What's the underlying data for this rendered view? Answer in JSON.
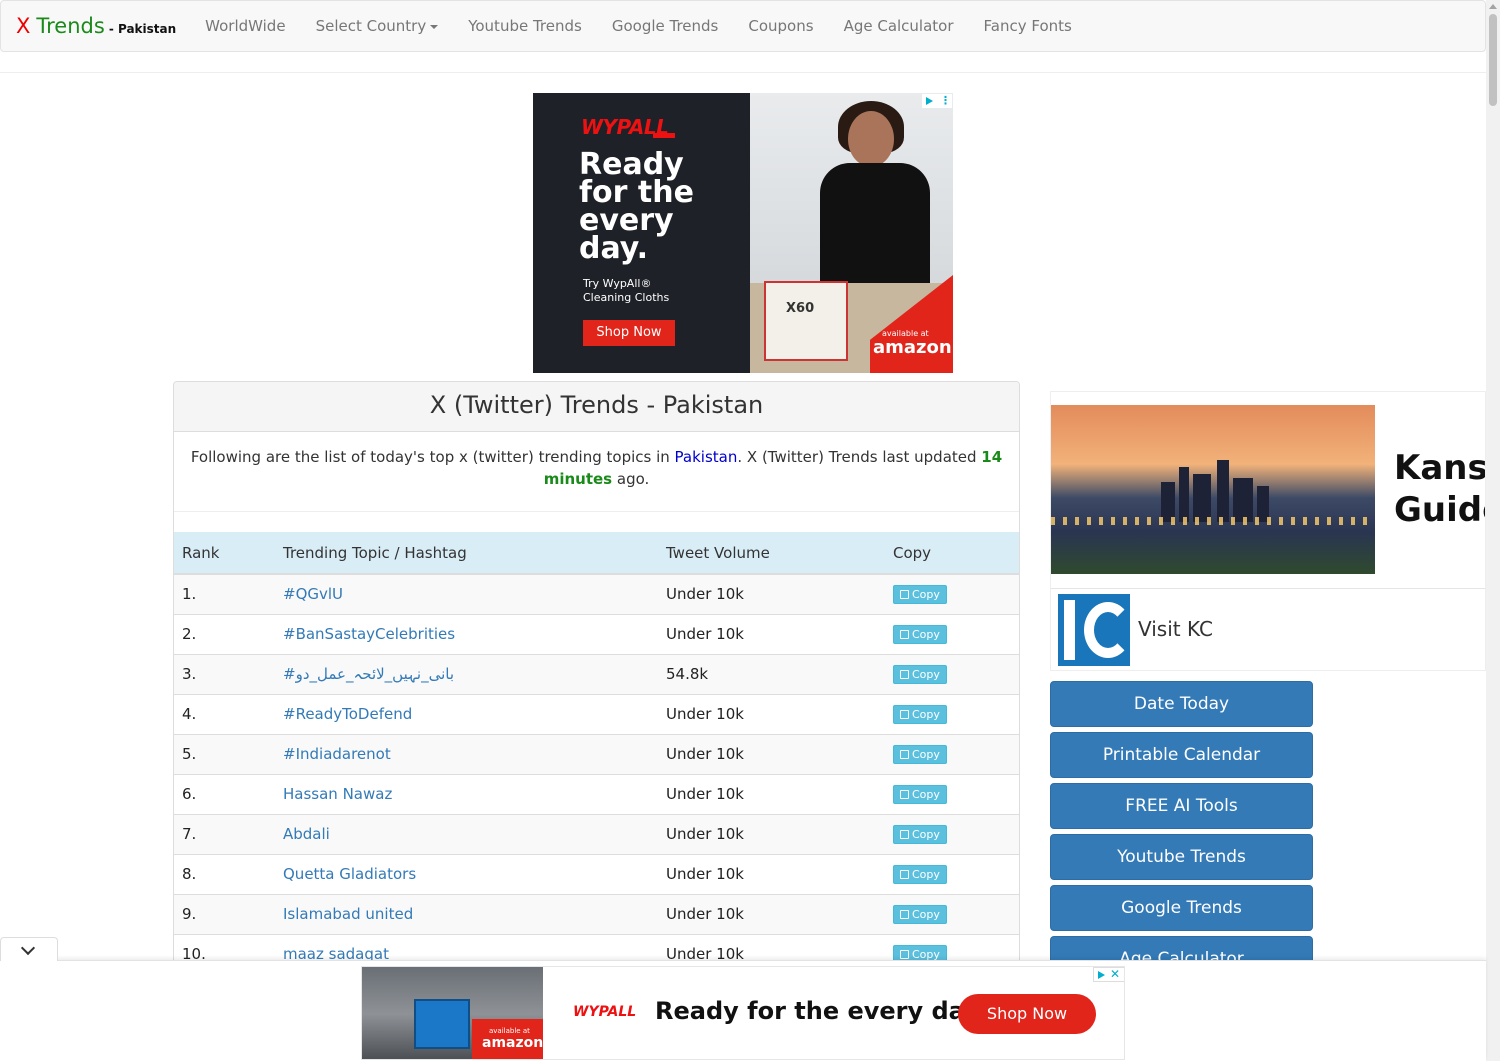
{
  "navbar": {
    "brand_x": "X",
    "brand_trends": "Trends",
    "brand_country": "- Pakistan",
    "items": [
      "WorldWide",
      "Select Country",
      "Youtube Trends",
      "Google Trends",
      "Coupons",
      "Age Calculator",
      "Fancy Fonts"
    ]
  },
  "ad_top": {
    "logo": "WYPALL",
    "headline": "Ready\nfor the\nevery\nday.",
    "sub": "Try WypAll®\nCleaning Cloths",
    "cta": "Shop Now",
    "box_label": "X60",
    "available": "available at",
    "amazon": "amazon"
  },
  "panel": {
    "title": "X (Twitter) Trends - Pakistan",
    "intro_prefix": "Following are the list of today's top x (twitter) trending topics in ",
    "intro_country": "Pakistan",
    "intro_middle": ". X (Twitter) Trends last updated ",
    "intro_time": "14 minutes",
    "intro_suffix": " ago."
  },
  "table": {
    "headers": [
      "Rank",
      "Trending Topic / Hashtag",
      "Tweet Volume",
      "Copy"
    ],
    "copy_label": "Copy",
    "rows": [
      {
        "rank": "1.",
        "topic": "#QGvlU",
        "volume": "Under 10k"
      },
      {
        "rank": "2.",
        "topic": "#BanSastayCelebrities",
        "volume": "Under 10k"
      },
      {
        "rank": "3.",
        "topic": "#بانی_نہیں_لائحہ_عمل_دو",
        "volume": "54.8k"
      },
      {
        "rank": "4.",
        "topic": "#ReadyToDefend",
        "volume": "Under 10k"
      },
      {
        "rank": "5.",
        "topic": "#Indiadarenot",
        "volume": "Under 10k"
      },
      {
        "rank": "6.",
        "topic": "Hassan Nawaz",
        "volume": "Under 10k"
      },
      {
        "rank": "7.",
        "topic": "Abdali",
        "volume": "Under 10k"
      },
      {
        "rank": "8.",
        "topic": "Quetta Gladiators",
        "volume": "Under 10k"
      },
      {
        "rank": "9.",
        "topic": "Islamabad united",
        "volume": "Under 10k"
      },
      {
        "rank": "10.",
        "topic": "maaz sadaqat",
        "volume": "Under 10k"
      }
    ]
  },
  "ad_right": {
    "title": "Kansa\nGuide",
    "visit": "Visit KC"
  },
  "sidebar": {
    "buttons": [
      "Date Today",
      "Printable Calendar",
      "FREE AI Tools",
      "Youtube Trends",
      "Google Trends",
      "Age Calculator"
    ]
  },
  "ad_bottom": {
    "logo": "WYPALL",
    "headline": "Ready for the every day.",
    "cta": "Shop Now",
    "available": "available at",
    "amazon": "amazon"
  }
}
